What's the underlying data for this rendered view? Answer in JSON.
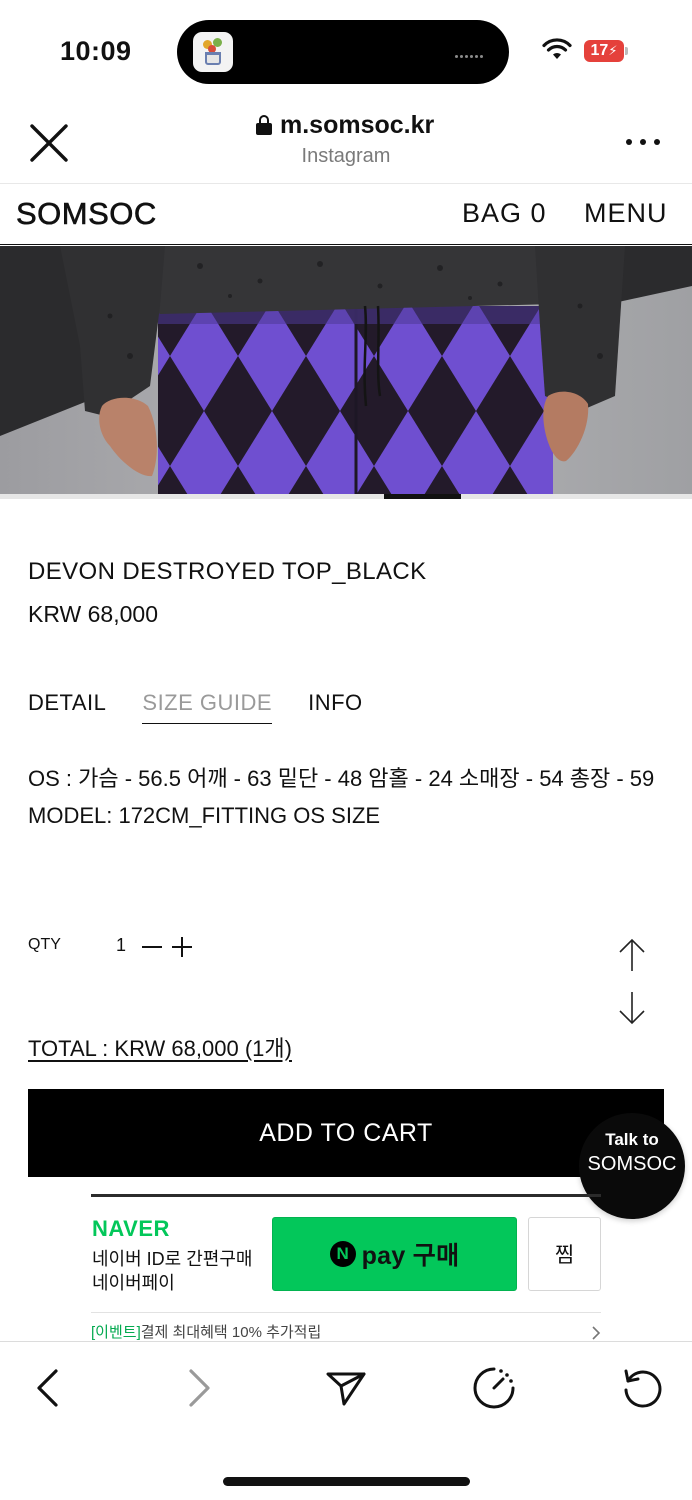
{
  "status_bar": {
    "time": "10:09",
    "battery": "17",
    "icons": [
      "cellular-dots-icon",
      "wifi-icon",
      "battery-charging-icon"
    ]
  },
  "browser": {
    "url": "m.somsoc.kr",
    "source": "Instagram",
    "icons": [
      "close-icon",
      "lock-icon",
      "more-icon"
    ]
  },
  "site_nav": {
    "logo": "SOMSOC",
    "bag": "BAG 0",
    "menu": "MENU"
  },
  "hero": {
    "image": "model-argyle-pants-photo",
    "carousel_position": "2"
  },
  "product": {
    "name": "DEVON DESTROYED TOP_BLACK",
    "price": "KRW 68,000"
  },
  "tabs": [
    {
      "label": "DETAIL",
      "active": false
    },
    {
      "label": "SIZE GUIDE",
      "active": true
    },
    {
      "label": "INFO",
      "active": false
    }
  ],
  "size_guide": {
    "line1": "OS : 가슴 - 56.5 어깨 - 63 밑단 - 48 암홀 - 24 소매장 - 54 총장 - 59",
    "line2": "MODEL: 172CM_FITTING OS SIZE"
  },
  "quantity": {
    "label": "QTY",
    "value": "1"
  },
  "total": "TOTAL : KRW 68,000 (1개)",
  "add_to_cart": "ADD TO CART",
  "talk_button": {
    "line1": "Talk to",
    "line2": "SOMSOC"
  },
  "naver": {
    "brand": "NAVER",
    "line1": "네이버 ID로 간편구매",
    "line2": "네이버페이",
    "npay_icon_letter": "N",
    "pay_button": "pay 구매",
    "zzim": "찜",
    "event_tag": "[이벤트]",
    "event_text": "결제 최대혜택 10% 추가적립",
    "brand_color": "#03c75a"
  },
  "toolbar": {
    "icons": [
      "back-icon",
      "forward-icon",
      "send-icon",
      "speed-icon",
      "reload-icon"
    ]
  }
}
